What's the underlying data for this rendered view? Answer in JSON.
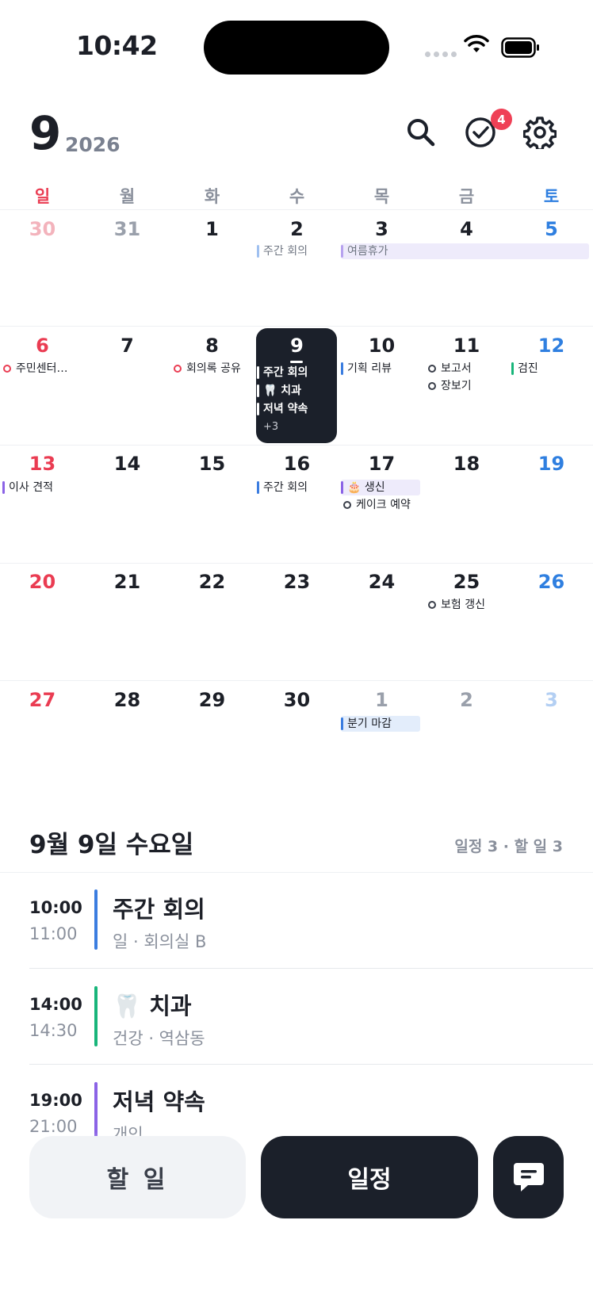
{
  "status": {
    "time": "10:42"
  },
  "header": {
    "month": "9",
    "year": "2026",
    "badge_count": "4"
  },
  "weekdays": [
    "일",
    "월",
    "화",
    "수",
    "목",
    "금",
    "토"
  ],
  "weeks": [
    [
      "30",
      "31",
      "1",
      "2",
      "3",
      "4",
      "5"
    ],
    [
      "6",
      "7",
      "8",
      "9",
      "10",
      "11",
      "12"
    ],
    [
      "13",
      "14",
      "15",
      "16",
      "17",
      "18",
      "19"
    ],
    [
      "20",
      "21",
      "22",
      "23",
      "24",
      "25",
      "26"
    ],
    [
      "27",
      "28",
      "29",
      "30",
      "1",
      "2",
      "3"
    ]
  ],
  "calendar_events": {
    "w1_wed": "주간 회의",
    "w1_thu": "여름휴가",
    "w2_sun": "주민센터…",
    "w2_tue": "회의록 공유",
    "w2_wed_1": "주간 회의",
    "w2_wed_2": "🦷 치과",
    "w2_wed_3": "저녁 약속",
    "w2_wed_more": "+3",
    "w2_thu": "기획 리뷰",
    "w2_fri_1": "보고서",
    "w2_fri_2": "장보기",
    "w2_sat": "검진",
    "w3_sun": "이사 견적",
    "w3_wed": "주간 회의",
    "w3_thu_1": "🎂 생신",
    "w3_thu_2": "케이크 예약",
    "w4_fri": "보험 갱신",
    "w5_thu": "분기 마감"
  },
  "colors": {
    "work": "#3b7de0",
    "health": "#18b57a",
    "personal": "#8b63e6",
    "todo_red": "#ea3c52",
    "vacation_bg": "#eeebfb",
    "deadline_bg": "#e3edfb",
    "dark": "#1b202a"
  },
  "agenda": {
    "date_title": "9월 9일 수요일",
    "summary": "일정 3 · 할 일 3",
    "items": [
      {
        "start": "10:00",
        "end": "11:00",
        "title": "주간 회의",
        "sub": "일 · 회의실 B"
      },
      {
        "start": "14:00",
        "end": "14:30",
        "title": "🦷 치과",
        "sub": "건강 · 역삼동"
      },
      {
        "start": "19:00",
        "end": "21:00",
        "title": "저녁 약속",
        "sub": "개인"
      }
    ]
  },
  "bottom": {
    "todo_label": "할 일",
    "event_label": "일정"
  }
}
